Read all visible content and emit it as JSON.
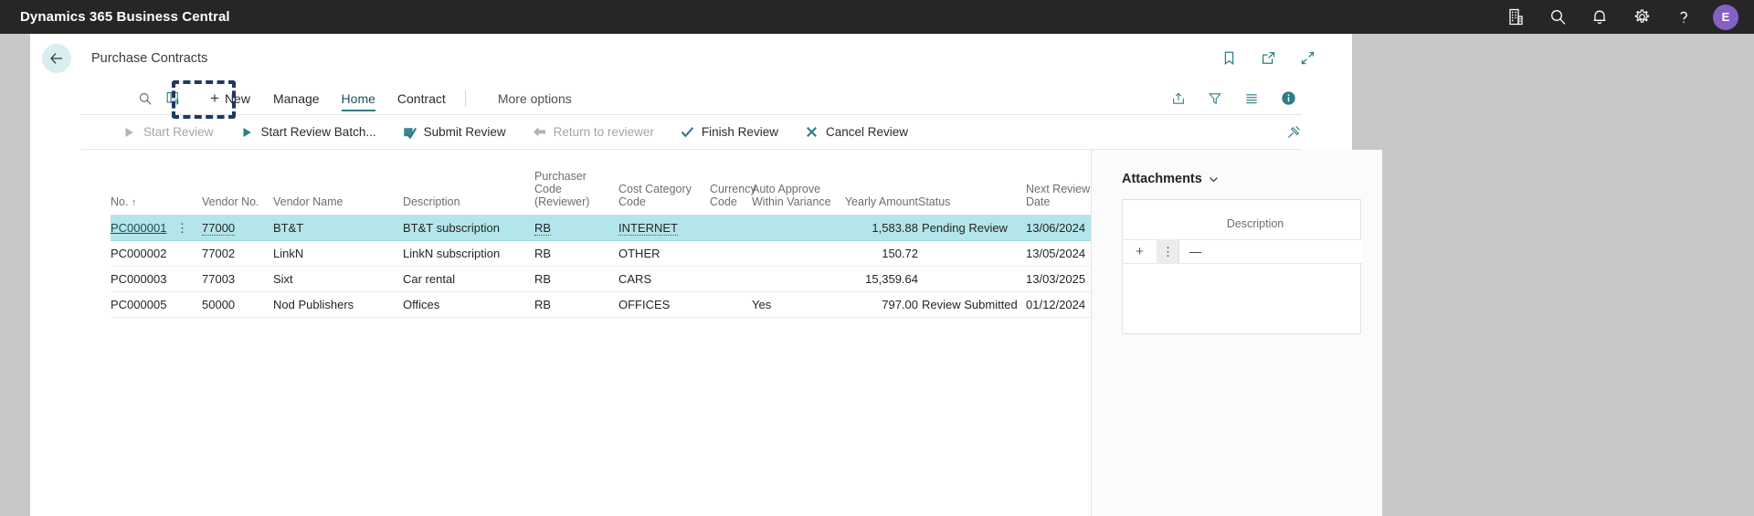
{
  "appbar": {
    "title": "Dynamics 365 Business Central",
    "icons": [
      {
        "name": "company-icon",
        "glyph": "company"
      },
      {
        "name": "search-icon",
        "glyph": "search"
      },
      {
        "name": "notifications-bell-icon",
        "glyph": "bell"
      },
      {
        "name": "settings-gear-icon",
        "glyph": "gear"
      },
      {
        "name": "help-question-icon",
        "glyph": "question"
      }
    ],
    "avatar_initial": "E",
    "avatar_color": "#8661c5"
  },
  "page_header": {
    "back_label": "back-arrow",
    "breadcrumb": "Purchase Contracts",
    "icons": [
      {
        "name": "bookmark-icon"
      },
      {
        "name": "open-in-new-window-icon"
      },
      {
        "name": "collapse-icon"
      }
    ]
  },
  "ribbon": {
    "search_icon": "search-icon",
    "open-in-excel_icon": "open-in-pages-icon",
    "new_label": "New",
    "tabs": [
      {
        "label": "Manage",
        "active": false
      },
      {
        "label": "Home",
        "active": true
      },
      {
        "label": "Contract",
        "active": false
      }
    ],
    "more_options_label": "More options",
    "right_icons": [
      {
        "name": "share-icon"
      },
      {
        "name": "filter-icon"
      },
      {
        "name": "list-view-icon"
      },
      {
        "name": "info-icon"
      }
    ]
  },
  "actions": [
    {
      "label": "Start Review",
      "icon": "play-icon",
      "disabled": true
    },
    {
      "label": "Start Review Batch...",
      "icon": "play-icon",
      "disabled": false
    },
    {
      "label": "Submit Review",
      "icon": "submit-check-icon",
      "disabled": false
    },
    {
      "label": "Return to reviewer",
      "icon": "return-arrow-icon",
      "disabled": true
    },
    {
      "label": "Finish Review",
      "icon": "checkmark-icon",
      "disabled": false
    },
    {
      "label": "Cancel Review",
      "icon": "cross-icon",
      "disabled": false
    }
  ],
  "actions_right_icon": "pin-actions-icon",
  "table": {
    "columns": [
      {
        "key": "no",
        "label": "No.",
        "sort": "↑",
        "align": "left"
      },
      {
        "key": "vendor_no",
        "label": "Vendor No.",
        "align": "left"
      },
      {
        "key": "vendor_name",
        "label": "Vendor Name",
        "align": "left"
      },
      {
        "key": "description",
        "label": "Description",
        "align": "left"
      },
      {
        "key": "purchaser_code",
        "label": "Purchaser\nCode\n(Reviewer)",
        "align": "left"
      },
      {
        "key": "cost_category_code",
        "label": "Cost Category\nCode",
        "align": "left"
      },
      {
        "key": "currency_code",
        "label": "Currency\nCode",
        "align": "left"
      },
      {
        "key": "auto_approve",
        "label": "Auto Approve\nWithin Variance",
        "align": "left"
      },
      {
        "key": "yearly_amount",
        "label": "Yearly Amount",
        "align": "right"
      },
      {
        "key": "status",
        "label": "Status",
        "align": "left"
      },
      {
        "key": "next_review_date",
        "label": "Next Review\nDate",
        "align": "left"
      }
    ],
    "rows": [
      {
        "selected": true,
        "no": "PC000001",
        "vendor_no": "77000",
        "vendor_name": "BT&T",
        "description": "BT&T subscription",
        "purchaser_code": "RB",
        "cost_category_code": "INTERNET",
        "currency_code": "",
        "auto_approve": "",
        "yearly_amount": "1,583.88",
        "status": "Pending Review",
        "next_review_date": "13/06/2024"
      },
      {
        "selected": false,
        "no": "PC000002",
        "vendor_no": "77002",
        "vendor_name": "LinkN",
        "description": "LinkN subscription",
        "purchaser_code": "RB",
        "cost_category_code": "OTHER",
        "currency_code": "",
        "auto_approve": "",
        "yearly_amount": "150.72",
        "status": "",
        "next_review_date": "13/05/2024"
      },
      {
        "selected": false,
        "no": "PC000003",
        "vendor_no": "77003",
        "vendor_name": "Sixt",
        "description": "Car rental",
        "purchaser_code": "RB",
        "cost_category_code": "CARS",
        "currency_code": "",
        "auto_approve": "",
        "yearly_amount": "15,359.64",
        "status": "",
        "next_review_date": "13/03/2025"
      },
      {
        "selected": false,
        "no": "PC000005",
        "vendor_no": "50000",
        "vendor_name": "Nod Publishers",
        "description": "Offices",
        "purchaser_code": "RB",
        "cost_category_code": "OFFICES",
        "currency_code": "",
        "auto_approve": "Yes",
        "yearly_amount": "797.00",
        "status": "Review Submitted",
        "next_review_date": "01/12/2024"
      }
    ]
  },
  "factbox": {
    "title": "Attachments",
    "column_header": "Description",
    "add_label": "+",
    "row_value": "—"
  },
  "colors": {
    "accent_teal": "#2d7d86",
    "selected_row": "#b3e6ea",
    "appbar_bg": "#262626",
    "focus_outline": "#1f3864"
  }
}
